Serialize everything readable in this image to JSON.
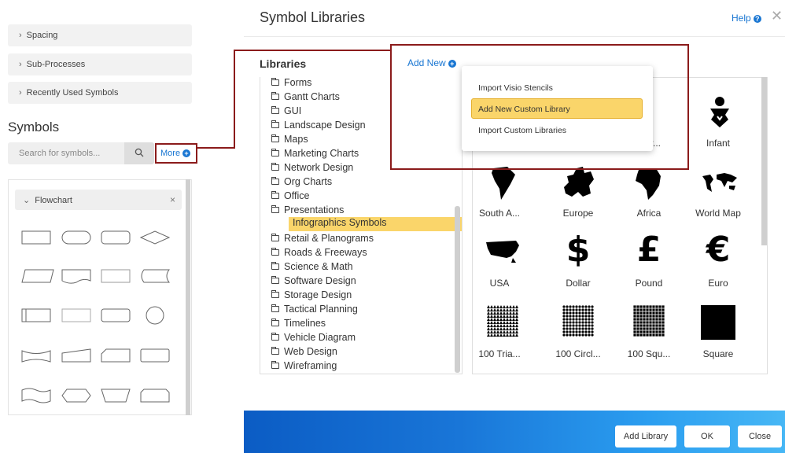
{
  "left_panel": {
    "accordion": [
      "Spacing",
      "Sub-Processes",
      "Recently Used Symbols"
    ],
    "symbols_title": "Symbols",
    "search_placeholder": "Search for symbols...",
    "more_label": "More",
    "flowchart_label": "Flowchart"
  },
  "dialog": {
    "title": "Symbol Libraries",
    "help_label": "Help",
    "libraries_heading": "Libraries",
    "add_new_label": "Add New",
    "tree_items": [
      "Forms",
      "Gantt Charts",
      "GUI",
      "Landscape Design",
      "Maps",
      "Marketing Charts",
      "Network Design",
      "Org Charts",
      "Office",
      "Presentations",
      "Infographics Symbols",
      "Retail & Planograms",
      "Roads & Freeways",
      "Science & Math",
      "Software Design",
      "Storage Design",
      "Tactical Planning",
      "Timelines",
      "Vehicle Diagram",
      "Web Design",
      "Wireframing"
    ],
    "selected_item": "Infographics Symbols",
    "symbols": [
      {
        "label": "...er...",
        "icon": "partial-icon"
      },
      {
        "label": "Infant",
        "icon": "infant-icon"
      },
      {
        "label": "South A...",
        "icon": "south-america-icon"
      },
      {
        "label": "Europe",
        "icon": "europe-icon"
      },
      {
        "label": "Africa",
        "icon": "africa-icon"
      },
      {
        "label": "World Map",
        "icon": "world-map-icon"
      },
      {
        "label": "USA",
        "icon": "usa-icon"
      },
      {
        "label": "Dollar",
        "icon": "dollar-icon",
        "glyph": "$"
      },
      {
        "label": "Pound",
        "icon": "pound-icon",
        "glyph": "£"
      },
      {
        "label": "Euro",
        "icon": "euro-icon",
        "glyph": "€"
      },
      {
        "label": "100 Tria...",
        "icon": "100-triangles-icon"
      },
      {
        "label": "100 Circl...",
        "icon": "100-circles-icon"
      },
      {
        "label": "100 Squ...",
        "icon": "100-squares-icon"
      },
      {
        "label": "Square",
        "icon": "square-icon"
      }
    ],
    "dropdown": [
      "Import Visio Stencils",
      "Add New Custom Library",
      "Import Custom Libraries"
    ],
    "footer_buttons": {
      "add_library": "Add Library",
      "ok": "OK",
      "close": "Close"
    }
  },
  "colors": {
    "accent": "#1976d2",
    "highlight": "#fad56a",
    "callout": "#8b1b1b"
  }
}
